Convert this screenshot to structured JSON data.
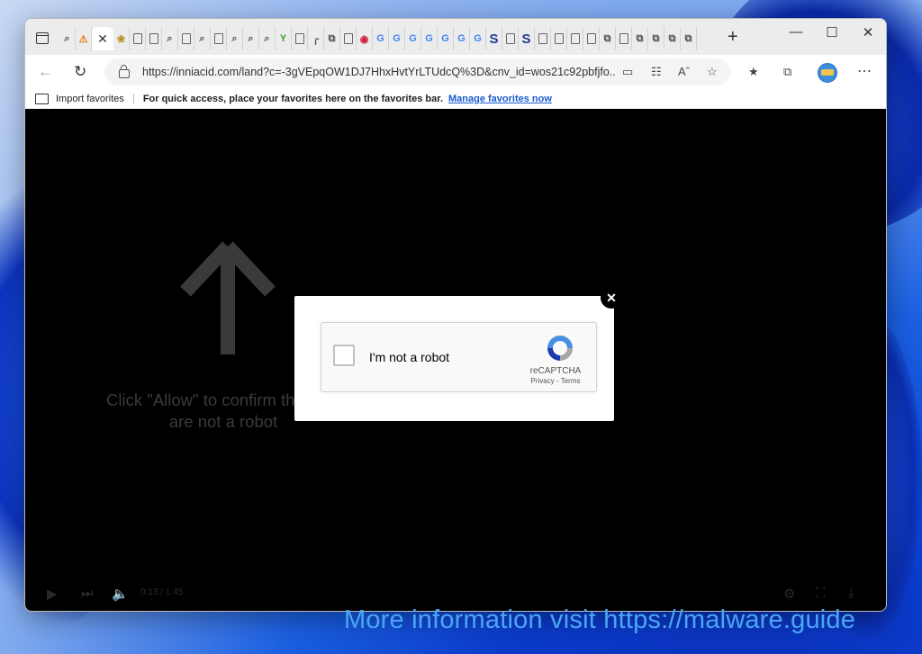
{
  "browser": {
    "url": "https://inniacid.com/land?c=-3gVEpqOW1DJ7HhxHvtYrLTUdcQ%3D&cnv_id=wos21c92pbfjfo...",
    "favorites_bar": {
      "import_label": "Import favorites",
      "hint": "For quick access, place your favorites here on the favorites bar.",
      "manage_link": "Manage favorites now"
    },
    "new_tab_symbol": "+",
    "window_controls": {
      "minimize": "—",
      "maximize": "☐",
      "close": "✕"
    },
    "tab_icons": [
      "search",
      "warning",
      "close-active",
      "fox",
      "doc",
      "doc",
      "search",
      "doc",
      "search",
      "doc",
      "search",
      "search",
      "search",
      "y",
      "doc",
      "curve",
      "multi",
      "doc",
      "lips",
      "g",
      "g",
      "g",
      "g",
      "g",
      "g",
      "g",
      "s",
      "doc",
      "s",
      "doc",
      "doc",
      "doc",
      "doc",
      "multi",
      "doc",
      "multi",
      "multi",
      "multi",
      "multi",
      "doc"
    ]
  },
  "page": {
    "click_text_line1": "Click \"Allow\" to confirm that you",
    "click_text_line2": "are not a robot",
    "video_time": "0:13 / 1:45"
  },
  "captcha": {
    "label": "I'm not a robot",
    "brand": "reCAPTCHA",
    "links": "Privacy - Terms",
    "close_symbol": "✕"
  },
  "watermark": "More information visit https://malware.guide"
}
